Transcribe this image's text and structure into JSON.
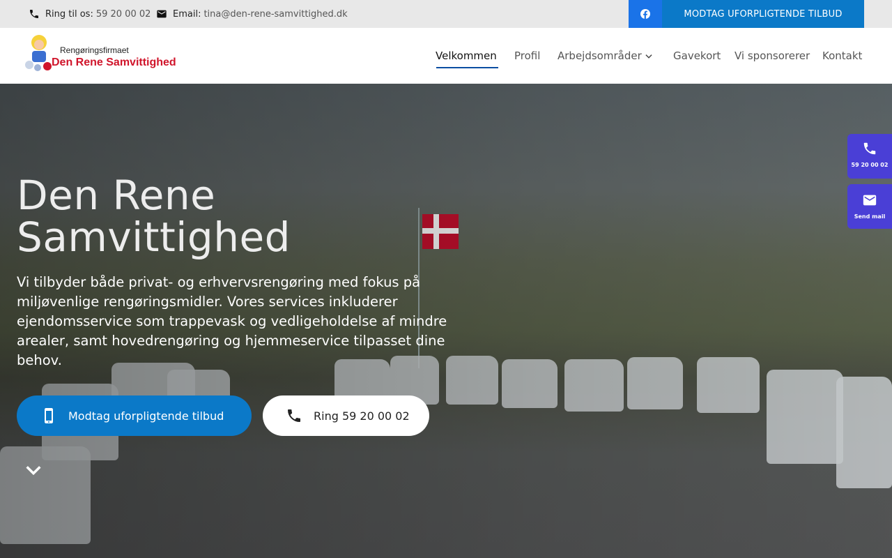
{
  "topbar": {
    "phone_label": "Ring til os:",
    "phone_value": "59 20 00 02",
    "email_label": "Email:",
    "email_value": "tina@den-rene-samvittighed.dk",
    "offer_button": "MODTAG UFORPLIGTENDE TILBUD"
  },
  "logo": {
    "line1": "Rengøringsfirmaet",
    "line2": "Den Rene Samvittighed"
  },
  "nav": {
    "items": [
      "Velkommen",
      "Profil",
      "Arbejdsområder",
      "Gavekort",
      "Vi sponsorerer",
      "Kontakt"
    ],
    "active": "Velkommen"
  },
  "hero": {
    "title_line1": "Den Rene",
    "title_line2": "Samvittighed",
    "text": "Vi tilbyder både privat- og erhvervsrengøring med fokus på miljøvenlige rengøringsmidler. Vores services inkluderer ejendomsservice som trappevask og vedligeholdelse af mindre arealer, samt hovedrengøring og hjemmeservice tilpasset dine behov.",
    "offer_button": "Modtag uforpligtende tilbud",
    "call_button": "Ring 59 20 00 02"
  },
  "side": {
    "phone": "59 20 00 02",
    "mail": "Send mail"
  },
  "colors": {
    "accent": "#0b79c8",
    "facebook": "#1a73e8",
    "side_panel": "#4a3fd6"
  }
}
